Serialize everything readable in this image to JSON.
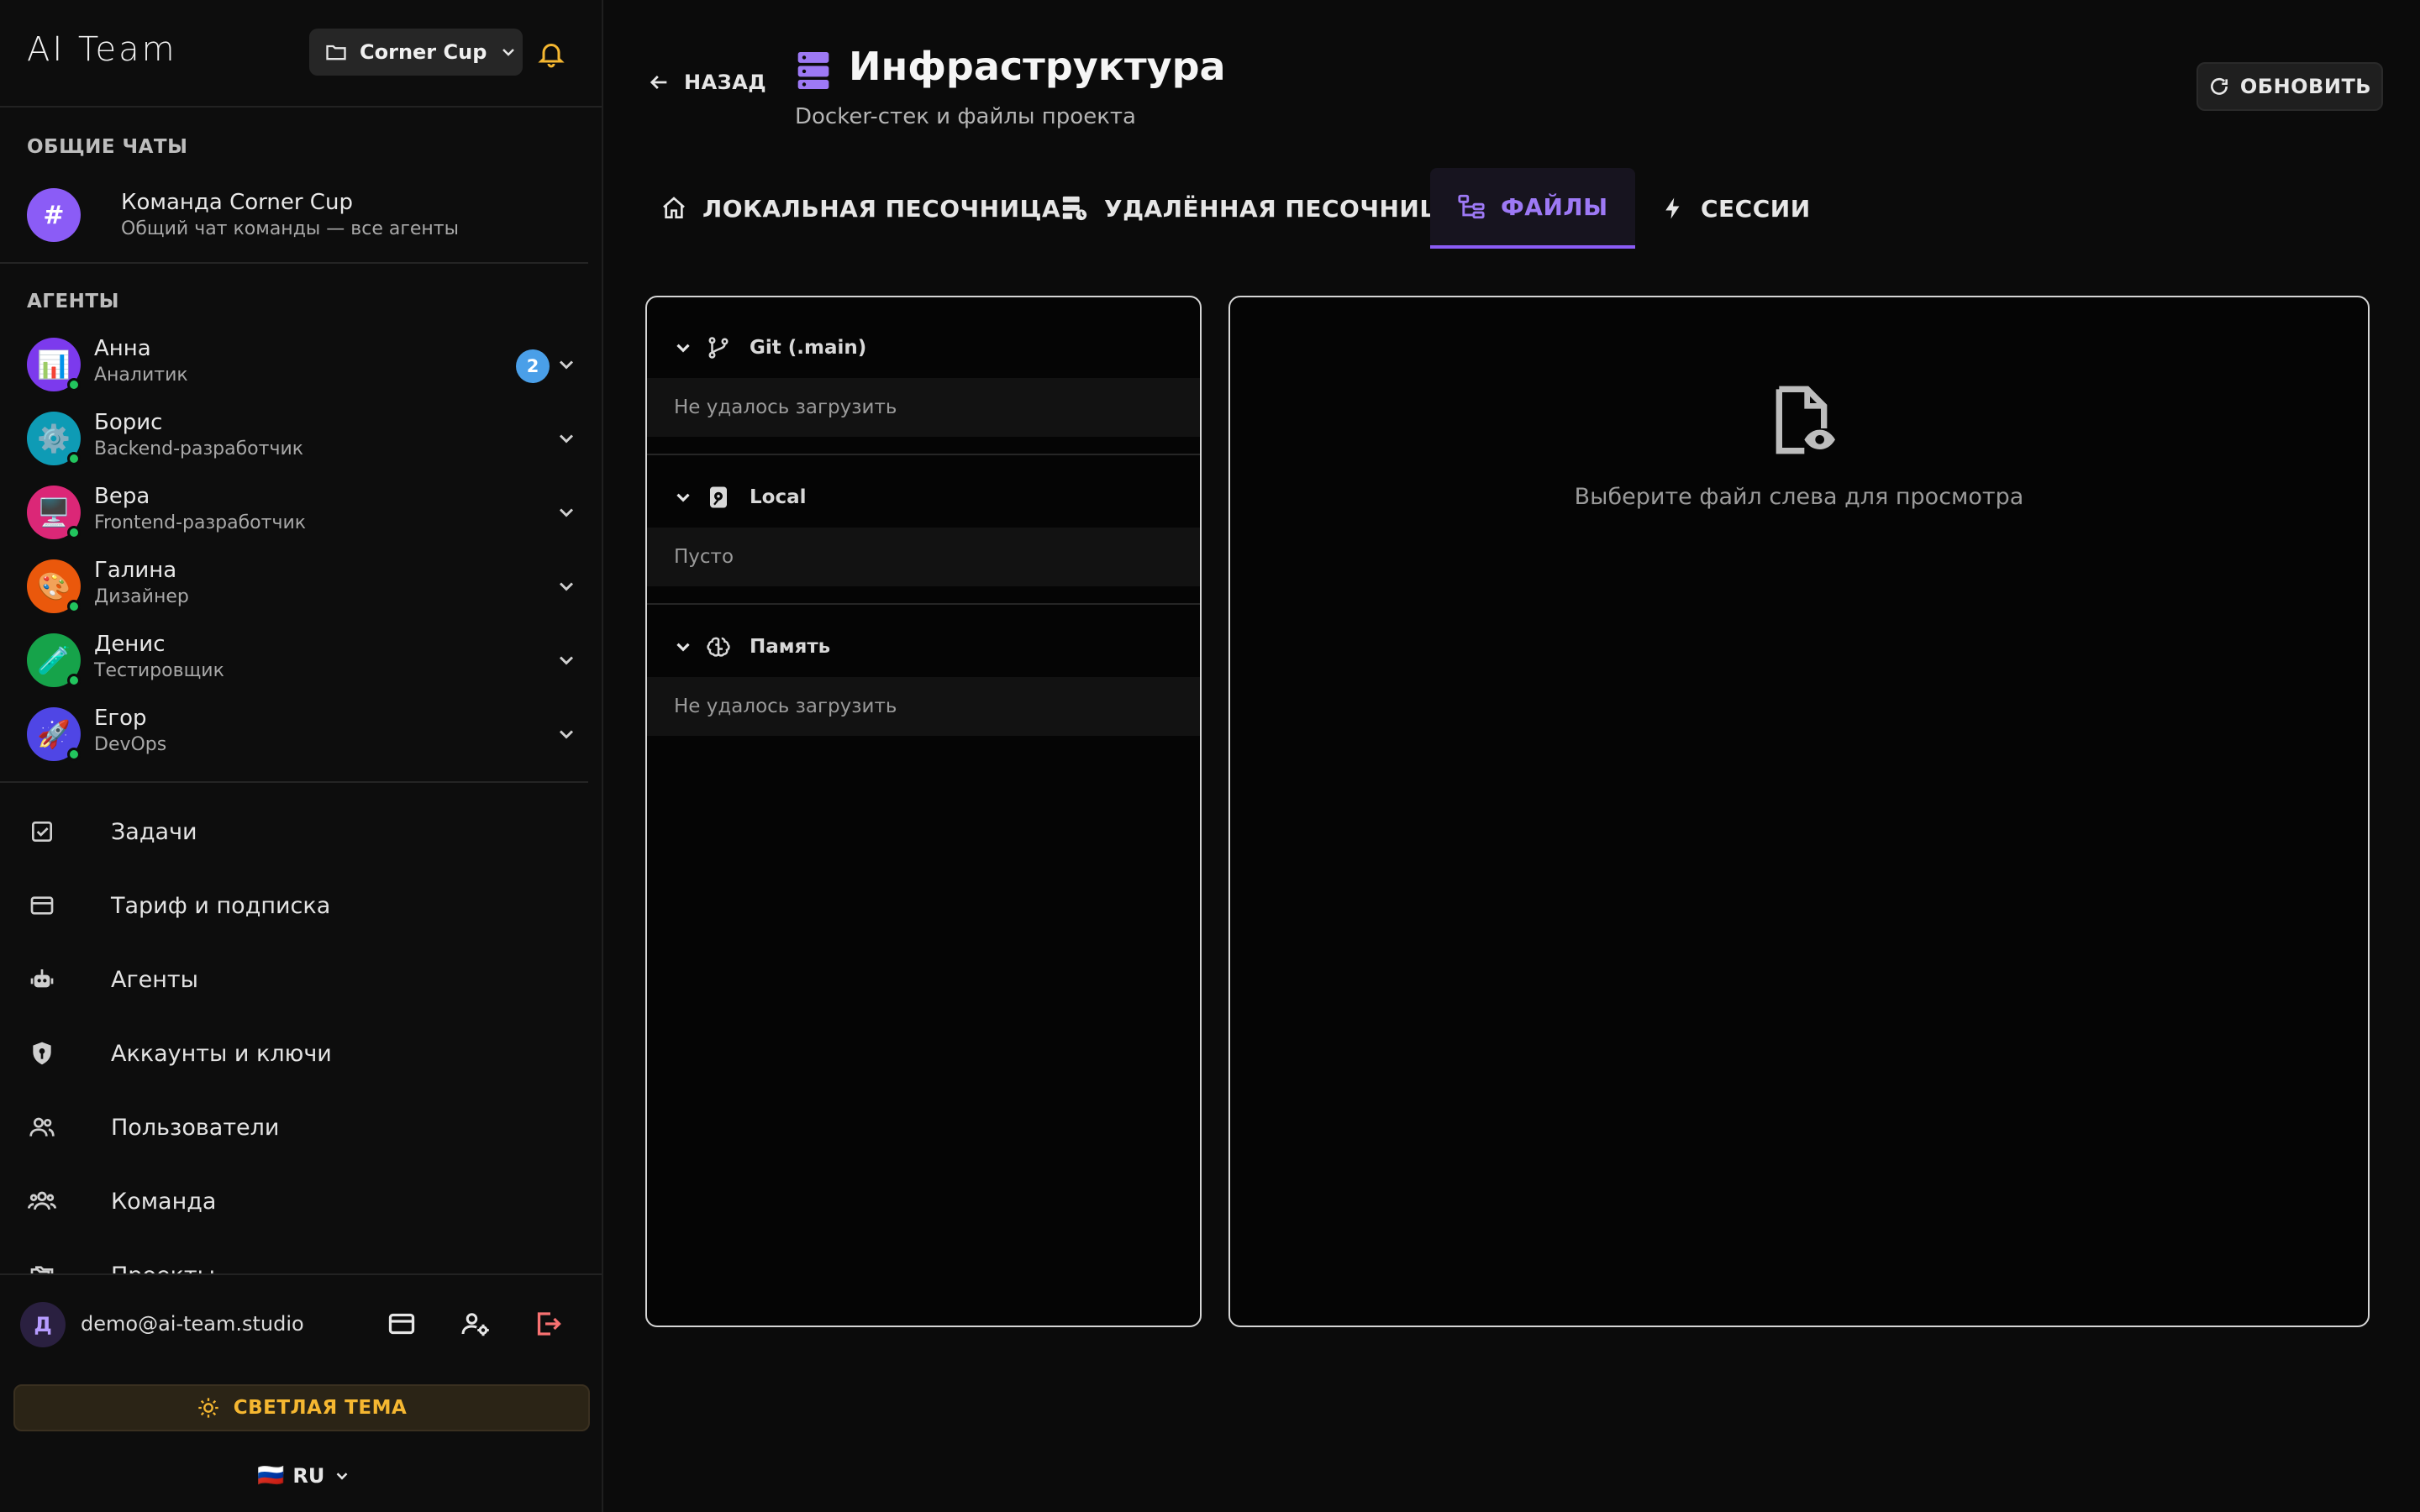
{
  "app": {
    "title": "AI Team",
    "project_selector": "Corner Cup"
  },
  "sidebar": {
    "general_chats_title": "ОБЩИЕ ЧАТЫ",
    "team_chat": {
      "avatar": "#",
      "name": "Команда Corner Cup",
      "subtitle": "Общий чат команды — все агенты"
    },
    "agents_title": "АГЕНТЫ",
    "agents": [
      {
        "name": "Анна",
        "role": "Аналитик",
        "emoji": "📊",
        "color": "#7c3aed",
        "badge": "2"
      },
      {
        "name": "Борис",
        "role": "Backend-разработчик",
        "emoji": "⚙️",
        "color": "#0e9bb5",
        "badge": ""
      },
      {
        "name": "Вера",
        "role": "Frontend-разработчик",
        "emoji": "🖥️",
        "color": "#db2777",
        "badge": ""
      },
      {
        "name": "Галина",
        "role": "Дизайнер",
        "emoji": "🎨",
        "color": "#ea580c",
        "badge": ""
      },
      {
        "name": "Денис",
        "role": "Тестировщик",
        "emoji": "🧪",
        "color": "#16a34a",
        "badge": ""
      },
      {
        "name": "Егор",
        "role": "DevOps",
        "emoji": "🚀",
        "color": "#4f46e5",
        "badge": ""
      }
    ],
    "nav": [
      {
        "label": "Задачи",
        "icon": "checkbox-icon"
      },
      {
        "label": "Тариф и подписка",
        "icon": "credit-card-icon"
      },
      {
        "label": "Агенты",
        "icon": "robot-icon"
      },
      {
        "label": "Аккаунты и ключи",
        "icon": "shield-key-icon"
      },
      {
        "label": "Пользователи",
        "icon": "users-icon"
      },
      {
        "label": "Команда",
        "icon": "team-icon"
      },
      {
        "label": "Проекты",
        "icon": "folders-icon"
      }
    ]
  },
  "footer": {
    "user_initial": "Д",
    "user_email": "demo@ai-team.studio",
    "theme_button": "СВЕТЛАЯ ТЕМА",
    "language": "RU",
    "flag": "🇷🇺"
  },
  "header": {
    "back_label": "НАЗАД",
    "title": "Инфраструктура",
    "subtitle": "Docker-стек и файлы проекта",
    "refresh_label": "ОБНОВИТЬ"
  },
  "tabs": [
    {
      "label": "ЛОКАЛЬНАЯ ПЕСОЧНИЦА",
      "icon": "home-icon",
      "active": false
    },
    {
      "label": "УДАЛЁННАЯ ПЕСОЧНИЦА",
      "icon": "remote-server-icon",
      "active": false
    },
    {
      "label": "ФАЙЛЫ",
      "icon": "file-tree-icon",
      "active": true
    },
    {
      "label": "СЕССИИ",
      "icon": "lightning-icon",
      "active": false
    }
  ],
  "file_tree": [
    {
      "title": "Git (.main)",
      "icon": "git-branch-icon",
      "message": "Не удалось загрузить"
    },
    {
      "title": "Local",
      "icon": "local-disk-icon",
      "message": "Пусто"
    },
    {
      "title": "Память",
      "icon": "brain-icon",
      "message": "Не удалось загрузить"
    }
  ],
  "preview": {
    "empty_text": "Выберите файл слева для просмотра"
  },
  "colors": {
    "accent": "#8b5cf6",
    "theme_button_text": "#f5b731",
    "online": "#22c55e",
    "badge": "#4a9fe8",
    "logout": "#f87171"
  }
}
